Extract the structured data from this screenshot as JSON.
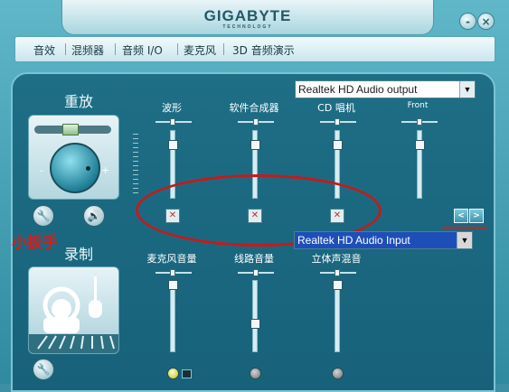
{
  "header": {
    "brand": "GIGABYTE",
    "brand_sub": "TECHNOLOGY"
  },
  "window": {
    "minimize_label": "-",
    "close_label": "×"
  },
  "tabs": [
    {
      "label": "音效"
    },
    {
      "label": "混频器"
    },
    {
      "label": "音频 I/O"
    },
    {
      "label": "麦克风"
    },
    {
      "label": "3D 音频演示"
    }
  ],
  "playback": {
    "title": "重放",
    "device": "Realtek HD Audio output",
    "knob_minus": "-",
    "knob_plus": "+",
    "balance_label": "III",
    "columns": [
      {
        "label": "波形",
        "level": 0.8,
        "muted": true
      },
      {
        "label": "软件合成器",
        "level": 0.8,
        "muted": true
      },
      {
        "label": "CD 唱机",
        "level": 0.8,
        "muted": true
      },
      {
        "label": "Front",
        "level": 0.8,
        "muted": false
      }
    ],
    "nav": {
      "prev": "<",
      "next": ">"
    }
  },
  "record": {
    "title": "录制",
    "device": "Realtek HD Audio Input",
    "columns": [
      {
        "label": "麦克风音量",
        "level": 0.95
      },
      {
        "label": "线路音量",
        "level": 0.4
      },
      {
        "label": "立体声混音",
        "level": 0.95
      }
    ],
    "selected_led": 0
  },
  "annotation": {
    "text": "小扳手"
  },
  "icons": {
    "wrench": "wrench-icon",
    "speaker": "speaker-icon",
    "mute": "muted-icon",
    "headset": "headset-icon"
  },
  "colors": {
    "panel": "#1e6e86",
    "annotation": "#d81c1c",
    "selected": "#1e4fb8"
  }
}
